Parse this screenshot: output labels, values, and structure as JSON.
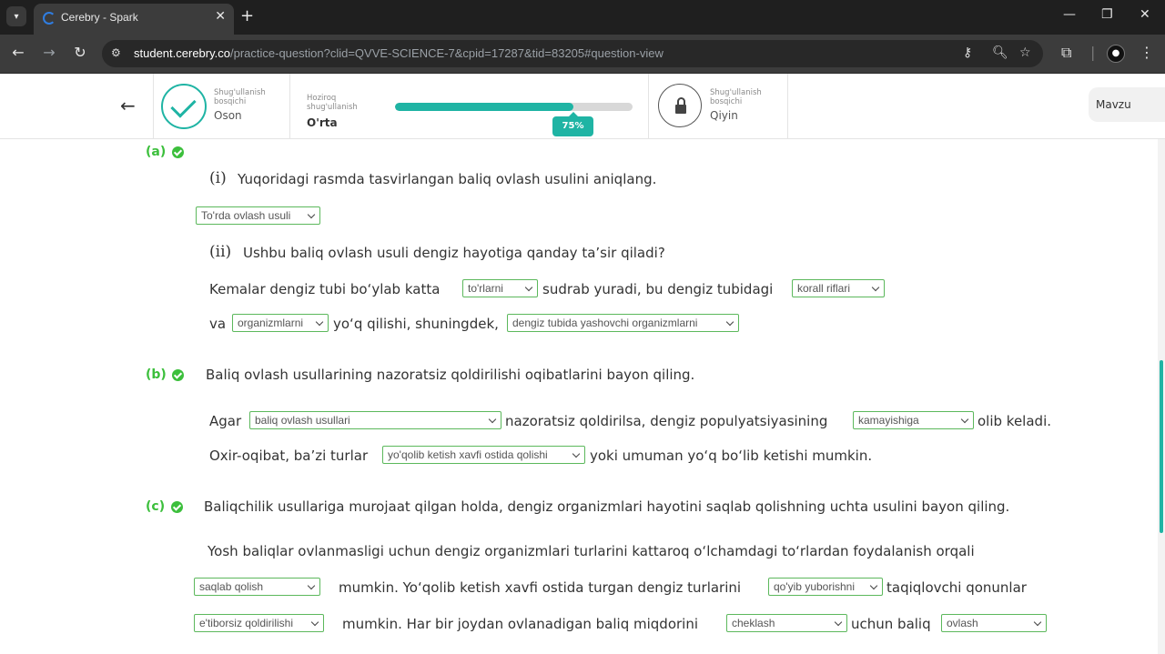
{
  "browser": {
    "tab_title": "Cerebry - Spark",
    "url_host": "student.cerebry.co",
    "url_path": "/practice-question?clid=QVVE-SCIENCE-7&cpid=17287&tid=83205#question-view"
  },
  "header": {
    "left_stage": {
      "small": "Shug'ullanish bosqichi",
      "name": "Oson"
    },
    "current_stage": {
      "small": "Hoziroq shug'ullanish",
      "name": "O'rta",
      "progress_percent": 75,
      "badge": "75%"
    },
    "right_stage": {
      "small": "Shug'ullanish bosqichi",
      "name": "Qiyin"
    },
    "topic_button": "Mavzu"
  },
  "question": {
    "a": {
      "label": "(a)",
      "i_num": "(i)",
      "i_text": "Yuqoridagi rasmda tasvirlangan baliq ovlash usulini aniqlang.",
      "i_answer": "To'rda ovlash usuli",
      "ii_num": "(ii)",
      "ii_text": "Ushbu baliq ovlash usuli dengiz hayotiga qanday ta’sir qiladi?",
      "line1_a": "Kemalar dengiz tubi bo‘ylab katta",
      "dd1": "to'rlarni",
      "line1_b": "sudrab yuradi, bu dengiz tubidagi",
      "dd2": "korall riflari",
      "line2_a": "va",
      "dd3": "organizmlarni",
      "line2_b": "yo‘q qilishi, shuningdek,",
      "dd4": "dengiz tubida yashovchi organizmlarni"
    },
    "b": {
      "label": "(b)",
      "text": "Baliq ovlash usullarining nazoratsiz qoldirilishi oqibatlarini bayon qiling.",
      "line1_a": "Agar",
      "dd1": "baliq ovlash usullari",
      "line1_b": "nazoratsiz qoldirilsa, dengiz populyatsiyasining",
      "dd2": "kamayishiga",
      "line1_c": "olib keladi.",
      "line2_a": "Oxir-oqibat, ba’zi turlar",
      "dd3": "yo'qolib ketish xavfi ostida qolishi",
      "line2_b": "yoki umuman yo‘q bo‘lib ketishi mumkin."
    },
    "c": {
      "label": "(c)",
      "text": "Baliqchilik usullariga murojaat qilgan holda, dengiz organizmlari hayotini saqlab qolishning uchta usulini bayon qiling.",
      "line1": "Yosh baliqlar ovlanmasligi uchun dengiz organizmlari turlarini kattaroq o‘lchamdagi to‘rlardan foydalanish orqali",
      "dd1": "saqlab qolish",
      "line2_a": "mumkin. Yo‘qolib ketish xavfi ostida turgan dengiz turlarini",
      "dd2": "qo'yib yuborishni",
      "line2_b": "taqiqlovchi qonunlar",
      "dd3": "e'tiborsiz qoldirilishi",
      "line3_a": "mumkin. Har bir joydan ovlanadigan baliq miqdorini",
      "dd4": "cheklash",
      "line3_b": "uchun baliq",
      "dd5": "ovlash"
    }
  }
}
